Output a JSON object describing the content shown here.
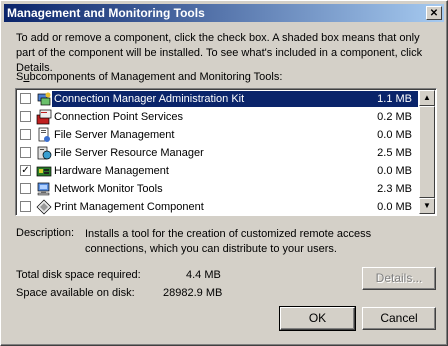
{
  "window": {
    "title": "Management and Monitoring Tools",
    "close_glyph": "✕"
  },
  "instructions": "To add or remove a component, click the check box. A shaded box means that only part of the component will be installed. To see what's included in a component, click Details.",
  "list_label": {
    "accel": "u",
    "prefix": "S",
    "rest": "bcomponents of Management and Monitoring Tools:"
  },
  "components": [
    {
      "name": "Connection Manager Administration Kit",
      "size": "1.1 MB",
      "checked": false,
      "selected": true,
      "icon": "connection-manager-icon"
    },
    {
      "name": "Connection Point Services",
      "size": "0.2 MB",
      "checked": false,
      "selected": false,
      "icon": "connection-point-icon"
    },
    {
      "name": "File Server Management",
      "size": "0.0 MB",
      "checked": false,
      "selected": false,
      "icon": "file-server-icon"
    },
    {
      "name": "File Server Resource Manager",
      "size": "2.5 MB",
      "checked": false,
      "selected": false,
      "icon": "resource-manager-icon"
    },
    {
      "name": "Hardware Management",
      "size": "0.0 MB",
      "checked": true,
      "selected": false,
      "icon": "hardware-icon"
    },
    {
      "name": "Network Monitor Tools",
      "size": "2.3 MB",
      "checked": false,
      "selected": false,
      "icon": "network-monitor-icon"
    },
    {
      "name": "Print Management Component",
      "size": "0.0 MB",
      "checked": false,
      "selected": false,
      "icon": "print-management-icon"
    }
  ],
  "description": {
    "label": "Description:",
    "text": "Installs a tool for the creation of customized remote access connections, which you can distribute to your users."
  },
  "disk": {
    "required_label": "Total disk space required:",
    "required_value": "4.4 MB",
    "available_label": "Space available on disk:",
    "available_value": "28982.9 MB"
  },
  "buttons": {
    "details": "Details...",
    "ok": "OK",
    "cancel": "Cancel"
  },
  "colors": {
    "selection": "#0a246a",
    "face": "#d4d0c8"
  }
}
